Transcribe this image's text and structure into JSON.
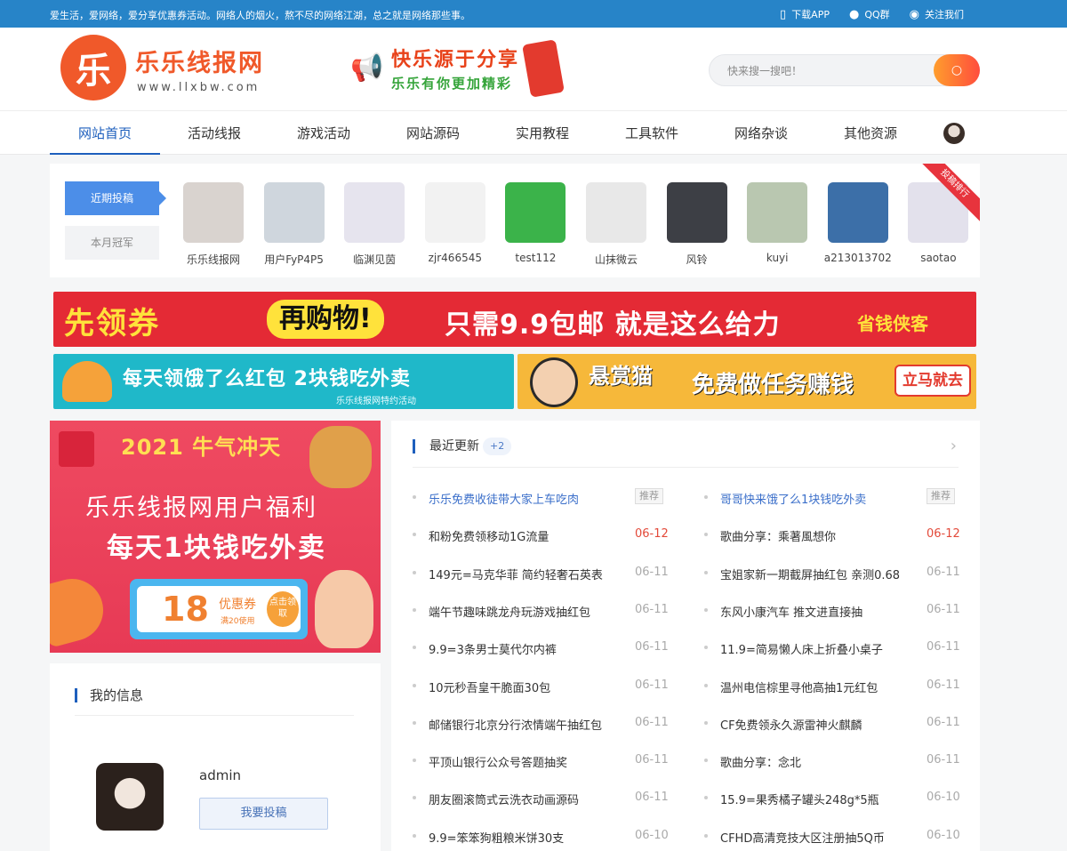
{
  "topbar": {
    "slogan": "爱生活，爱网络，爱分享优惠券活动。网络人的烟火，熬不尽的网络江湖，总之就是网络那些事。",
    "links": [
      {
        "label": "下载APP",
        "icon": "mobile-icon"
      },
      {
        "label": "QQ群",
        "icon": "qq-icon"
      },
      {
        "label": "关注我们",
        "icon": "wechat-icon"
      }
    ]
  },
  "header": {
    "logo_mark": "乐",
    "logo_text": "乐乐线报网",
    "logo_url": "www.llxbw.com",
    "slogan_line1": "快乐源于分享",
    "slogan_line2": "乐乐有你更加精彩",
    "search_placeholder": "快来搜一搜吧！"
  },
  "nav": {
    "items": [
      "网站首页",
      "活动线报",
      "游戏活动",
      "网站源码",
      "实用教程",
      "工具软件",
      "网络杂谈",
      "其他资源"
    ],
    "active": 0
  },
  "contributors": {
    "tabs": [
      "近期投稿",
      "本月冠军"
    ],
    "ribbon": "投稿排行",
    "users": [
      {
        "name": "乐乐线报网",
        "color": "#d9d3cf"
      },
      {
        "name": "用户FyP4P5",
        "color": "#cfd6dd"
      },
      {
        "name": "临渊见茵",
        "color": "#e6e4ee"
      },
      {
        "name": "zjr466545",
        "color": "#f2f2f2"
      },
      {
        "name": "test112",
        "color": "#3bb34a"
      },
      {
        "name": "山抹微云",
        "color": "#e8e8e8"
      },
      {
        "name": "风铃",
        "color": "#3d3f45"
      },
      {
        "name": "kuyi",
        "color": "#b9c7b0"
      },
      {
        "name": "a213013702",
        "color": "#3c6fa8"
      },
      {
        "name": "saotao",
        "color": "#e3e1ec"
      }
    ]
  },
  "banners": {
    "full": {
      "part1": "先领券",
      "part2": "再购物!",
      "part3": "只需9.9包邮 就是这么给力",
      "part4": "省钱侠客"
    },
    "left": {
      "main": "每天领饿了么红包 2块钱吃外卖",
      "sub": "乐乐线报网特约活动"
    },
    "right": {
      "part1": "悬赏猫",
      "part2": "免费做任务赚钱",
      "button": "立马就去"
    }
  },
  "promo": {
    "year": "2021 牛气冲天",
    "line1": "乐乐线报网用户福利",
    "line2": "每天1块钱吃外卖",
    "coupon_value": "18",
    "coupon_title": "优惠券",
    "coupon_sub": "满20使用",
    "get_label": "点击领取"
  },
  "myinfo": {
    "title": "我的信息",
    "username": "admin",
    "button": "我要投稿"
  },
  "latest": {
    "title": "最近更新",
    "count": "+2",
    "left": [
      {
        "title": "乐乐免费收徒带大家上车吃肉",
        "tag": "推荐"
      },
      {
        "title": "和粉免费领移动1G流量",
        "date": "06-12",
        "red": true
      },
      {
        "title": "149元=马克华菲 简约轻奢石英表",
        "date": "06-11"
      },
      {
        "title": "端午节趣味跳龙舟玩游戏抽红包",
        "date": "06-11"
      },
      {
        "title": "9.9=3条男士莫代尔内裤",
        "date": "06-11"
      },
      {
        "title": "10元秒吾皇干脆面30包",
        "date": "06-11"
      },
      {
        "title": "邮储银行北京分行浓情端午抽红包",
        "date": "06-11"
      },
      {
        "title": "平顶山银行公众号答题抽奖",
        "date": "06-11"
      },
      {
        "title": "朋友圈滚筒式云洗衣动画源码",
        "date": "06-11"
      },
      {
        "title": "9.9=笨笨狗粗粮米饼30支",
        "date": "06-10"
      }
    ],
    "right": [
      {
        "title": "哥哥快来饿了么1块钱吃外卖",
        "tag": "推荐"
      },
      {
        "title": "歌曲分享：乘著風想你",
        "date": "06-12",
        "red": true
      },
      {
        "title": "宝姐家新一期截屏抽红包 亲测0.68",
        "date": "06-11"
      },
      {
        "title": "东风小康汽车 推文进直接抽",
        "date": "06-11"
      },
      {
        "title": "11.9=简易懒人床上折叠小桌子",
        "date": "06-11"
      },
      {
        "title": "温州电信棕里寻他高抽1元红包",
        "date": "06-11"
      },
      {
        "title": "CF免费领永久源雷神火麒麟",
        "date": "06-11"
      },
      {
        "title": "歌曲分享：念北",
        "date": "06-11"
      },
      {
        "title": "15.9=果秀橘子罐头248g*5瓶",
        "date": "06-10"
      },
      {
        "title": "CFHD高清竞技大区注册抽5Q币",
        "date": "06-10"
      }
    ]
  }
}
